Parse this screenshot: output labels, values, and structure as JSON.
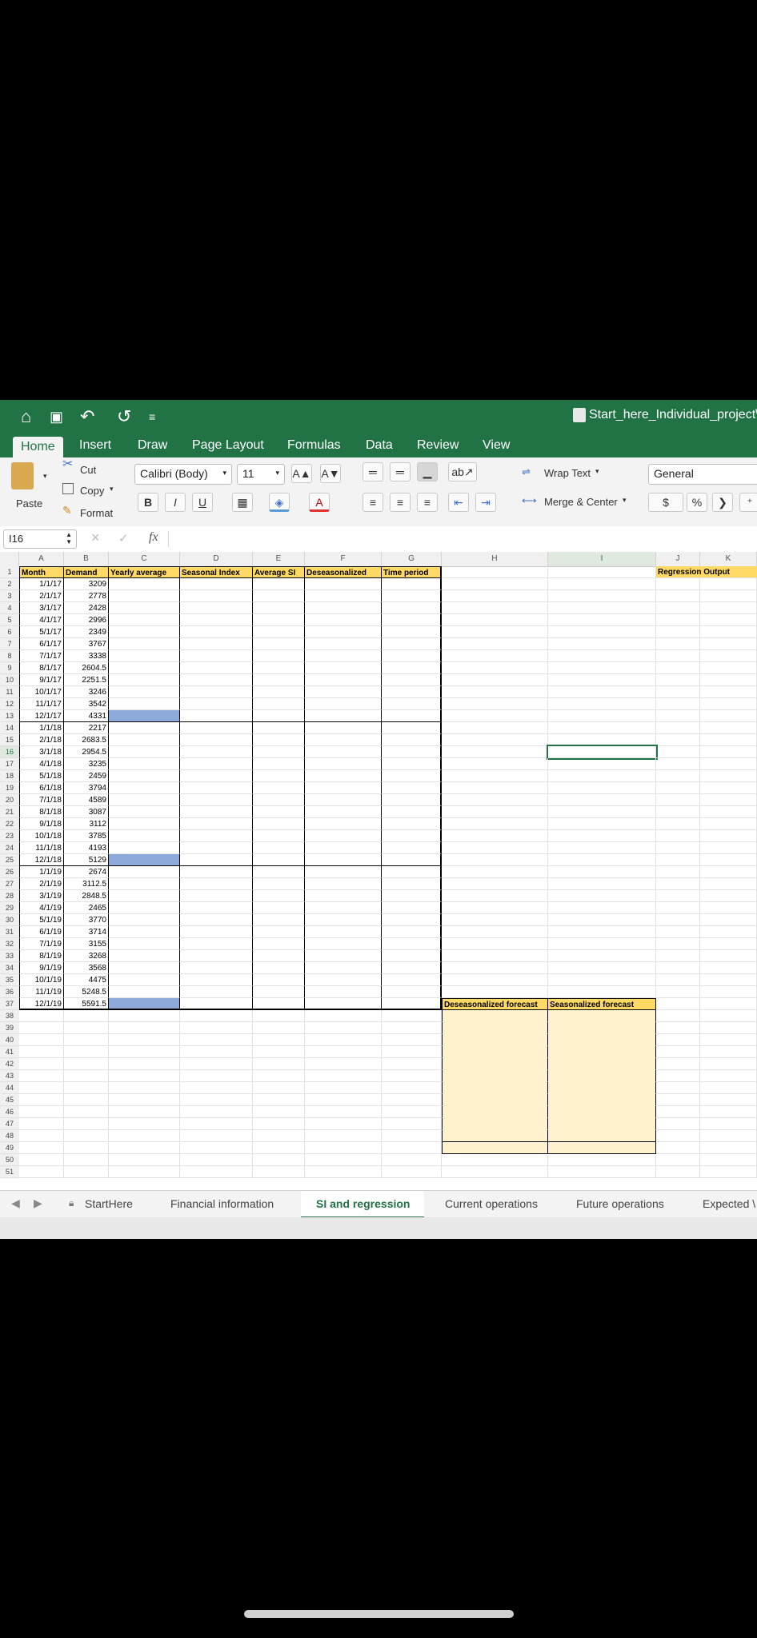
{
  "titlebar": {
    "title": "Start_here_Individual_project\\",
    "home_icon": "⌂",
    "save_icon": "▣",
    "undo_icon": "↶",
    "redo_icon": "↺",
    "more_icon": "≡"
  },
  "tabs": [
    "Home",
    "Insert",
    "Draw",
    "Page Layout",
    "Formulas",
    "Data",
    "Review",
    "View"
  ],
  "ribbon": {
    "paste": "Paste",
    "cut": "Cut",
    "copy": "Copy",
    "format": "Format",
    "font_name": "Calibri (Body)",
    "font_size": "11",
    "bold": "B",
    "italic": "I",
    "underline": "U",
    "increase_font": "A▲",
    "decrease_font": "A▼",
    "font_color": "A",
    "wrap_text": "Wrap Text",
    "merge_center": "Merge & Center",
    "number_format": "General",
    "currency": "$",
    "percent": "%",
    "comma": "❯"
  },
  "formula_bar": {
    "name_box": "I16",
    "fx": "fx",
    "cancel": "×",
    "enter": "✓",
    "value": ""
  },
  "columns": [
    "A",
    "B",
    "C",
    "D",
    "E",
    "F",
    "G",
    "H",
    "I",
    "J",
    "K"
  ],
  "headers": {
    "month": "Month",
    "demand": "Demand",
    "yearly_average": "Yearly average",
    "seasonal_index": "Seasonal Index",
    "average_si": "Average SI",
    "deseasonalized": "Deseasonalized",
    "time_period": "Time period",
    "regression_output": "Regression Output",
    "deseasonalized_forecast": "Deseasonalized forecast",
    "seasonalized_forecast": "Seasonalized forecast"
  },
  "rows": [
    {
      "month": "1/1/17",
      "demand": "3209"
    },
    {
      "month": "2/1/17",
      "demand": "2778"
    },
    {
      "month": "3/1/17",
      "demand": "2428"
    },
    {
      "month": "4/1/17",
      "demand": "2996"
    },
    {
      "month": "5/1/17",
      "demand": "2349"
    },
    {
      "month": "6/1/17",
      "demand": "3767"
    },
    {
      "month": "7/1/17",
      "demand": "3338"
    },
    {
      "month": "8/1/17",
      "demand": "2604.5"
    },
    {
      "month": "9/1/17",
      "demand": "2251.5"
    },
    {
      "month": "10/1/17",
      "demand": "3246"
    },
    {
      "month": "11/1/17",
      "demand": "3542"
    },
    {
      "month": "12/1/17",
      "demand": "4331"
    },
    {
      "month": "1/1/18",
      "demand": "2217"
    },
    {
      "month": "2/1/18",
      "demand": "2683.5"
    },
    {
      "month": "3/1/18",
      "demand": "2954.5"
    },
    {
      "month": "4/1/18",
      "demand": "3235"
    },
    {
      "month": "5/1/18",
      "demand": "2459"
    },
    {
      "month": "6/1/18",
      "demand": "3794"
    },
    {
      "month": "7/1/18",
      "demand": "4589"
    },
    {
      "month": "8/1/18",
      "demand": "3087"
    },
    {
      "month": "9/1/18",
      "demand": "3112"
    },
    {
      "month": "10/1/18",
      "demand": "3785"
    },
    {
      "month": "11/1/18",
      "demand": "4193"
    },
    {
      "month": "12/1/18",
      "demand": "5129"
    },
    {
      "month": "1/1/19",
      "demand": "2674"
    },
    {
      "month": "2/1/19",
      "demand": "3112.5"
    },
    {
      "month": "3/1/19",
      "demand": "2848.5"
    },
    {
      "month": "4/1/19",
      "demand": "2465"
    },
    {
      "month": "5/1/19",
      "demand": "3770"
    },
    {
      "month": "6/1/19",
      "demand": "3714"
    },
    {
      "month": "7/1/19",
      "demand": "3155"
    },
    {
      "month": "8/1/19",
      "demand": "3268"
    },
    {
      "month": "9/1/19",
      "demand": "3568"
    },
    {
      "month": "10/1/19",
      "demand": "4475"
    },
    {
      "month": "11/1/19",
      "demand": "5248.5"
    },
    {
      "month": "12/1/19",
      "demand": "5591.5"
    }
  ],
  "sheets": [
    "StartHere",
    "Financial information",
    "SI and regression",
    "Current operations",
    "Future operations",
    "Expected \\"
  ],
  "active_sheet": "SI and regression",
  "colors": {
    "accent": "#217346",
    "header_fill": "#ffd966",
    "forecast_fill": "#fff2cc",
    "highlight_fill": "#8eaadb"
  }
}
